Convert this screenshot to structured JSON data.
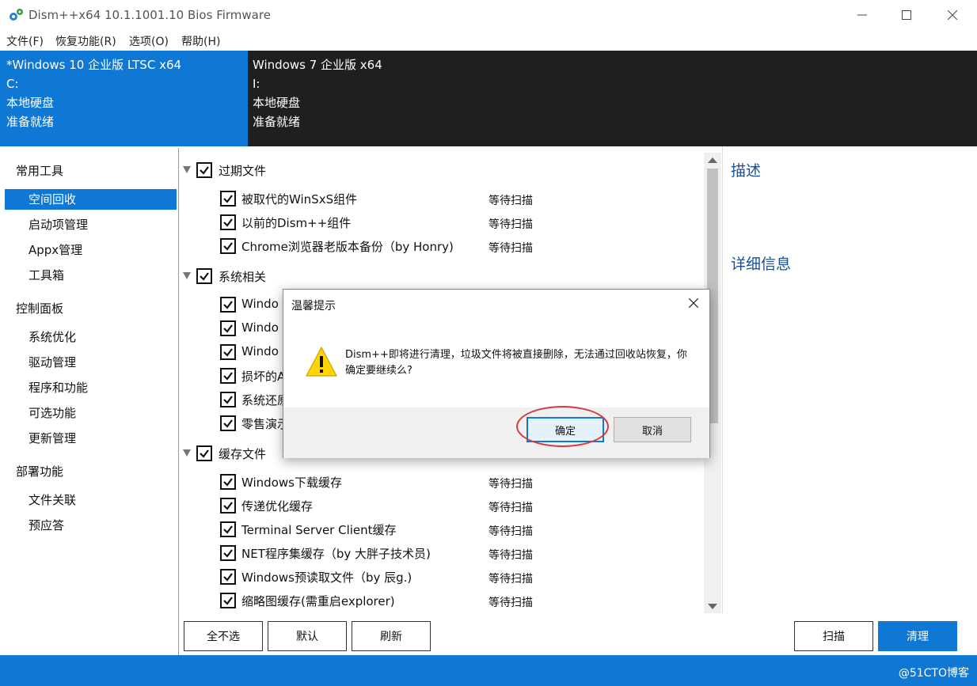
{
  "window": {
    "title": "Dism++x64 10.1.1001.10 Bios Firmware",
    "app_icon": "gears-icon"
  },
  "menu": [
    "文件(F)",
    "恢复功能(R)",
    "选项(O)",
    "帮助(H)"
  ],
  "sessions": [
    {
      "name": "*Windows 10 企业版 LTSC x64",
      "drive": "C:",
      "type": "本地硬盘",
      "state": "准备就绪"
    },
    {
      "name": "Windows 7 企业版 x64",
      "drive": "I:",
      "type": "本地硬盘",
      "state": "准备就绪"
    }
  ],
  "sidebar": {
    "groups": [
      {
        "label": "常用工具",
        "items": [
          "空间回收",
          "启动项管理",
          "Appx管理",
          "工具箱"
        ]
      },
      {
        "label": "控制面板",
        "items": [
          "系统优化",
          "驱动管理",
          "程序和功能",
          "可选功能",
          "更新管理"
        ]
      },
      {
        "label": "部署功能",
        "items": [
          "文件关联",
          "预应答"
        ]
      }
    ],
    "selected": "空间回收"
  },
  "list": {
    "groups": [
      {
        "label": "过期文件",
        "items": [
          {
            "label": "被取代的WinSxS组件",
            "status": "等待扫描"
          },
          {
            "label": "以前的Dism++组件",
            "status": "等待扫描"
          },
          {
            "label": "Chrome浏览器老版本备份（by Honry)",
            "status": "等待扫描"
          }
        ]
      },
      {
        "label": "系统相关",
        "items": [
          {
            "label": "Windo",
            "status": ""
          },
          {
            "label": "Windo",
            "status": ""
          },
          {
            "label": "Windo",
            "status": ""
          },
          {
            "label": "损坏的A",
            "status": ""
          },
          {
            "label": "系统还原",
            "status": ""
          },
          {
            "label": "零售演示",
            "status": ""
          }
        ]
      },
      {
        "label": "缓存文件",
        "items": [
          {
            "label": "Windows下载缓存",
            "status": "等待扫描"
          },
          {
            "label": "传递优化缓存",
            "status": "等待扫描"
          },
          {
            "label": "Terminal Server Client缓存",
            "status": "等待扫描"
          },
          {
            "label": "NET程序集缓存（by 大胖子技术员)",
            "status": "等待扫描"
          },
          {
            "label": "Windows预读取文件（by 辰g.)",
            "status": "等待扫描"
          },
          {
            "label": "缩略图缓存(需重启explorer)",
            "status": "等待扫描"
          }
        ]
      }
    ]
  },
  "right_pane": {
    "description_title": "描述",
    "details_title": "详细信息"
  },
  "buttons": {
    "deselect_all": "全不选",
    "default": "默认",
    "refresh": "刷新",
    "scan": "扫描",
    "clean": "清理"
  },
  "dialog": {
    "title": "温馨提示",
    "message": "Dism++即将进行清理，垃圾文件将被直接删除，无法通过回收站恢复，你确定要继续么?",
    "ok": "确定",
    "cancel": "取消",
    "icon": "warning-icon"
  },
  "watermark": "@51CTO博客",
  "colors": {
    "accent": "#0e78d4",
    "dark": "#1f1f1f",
    "annotation": "#d93b3b"
  }
}
